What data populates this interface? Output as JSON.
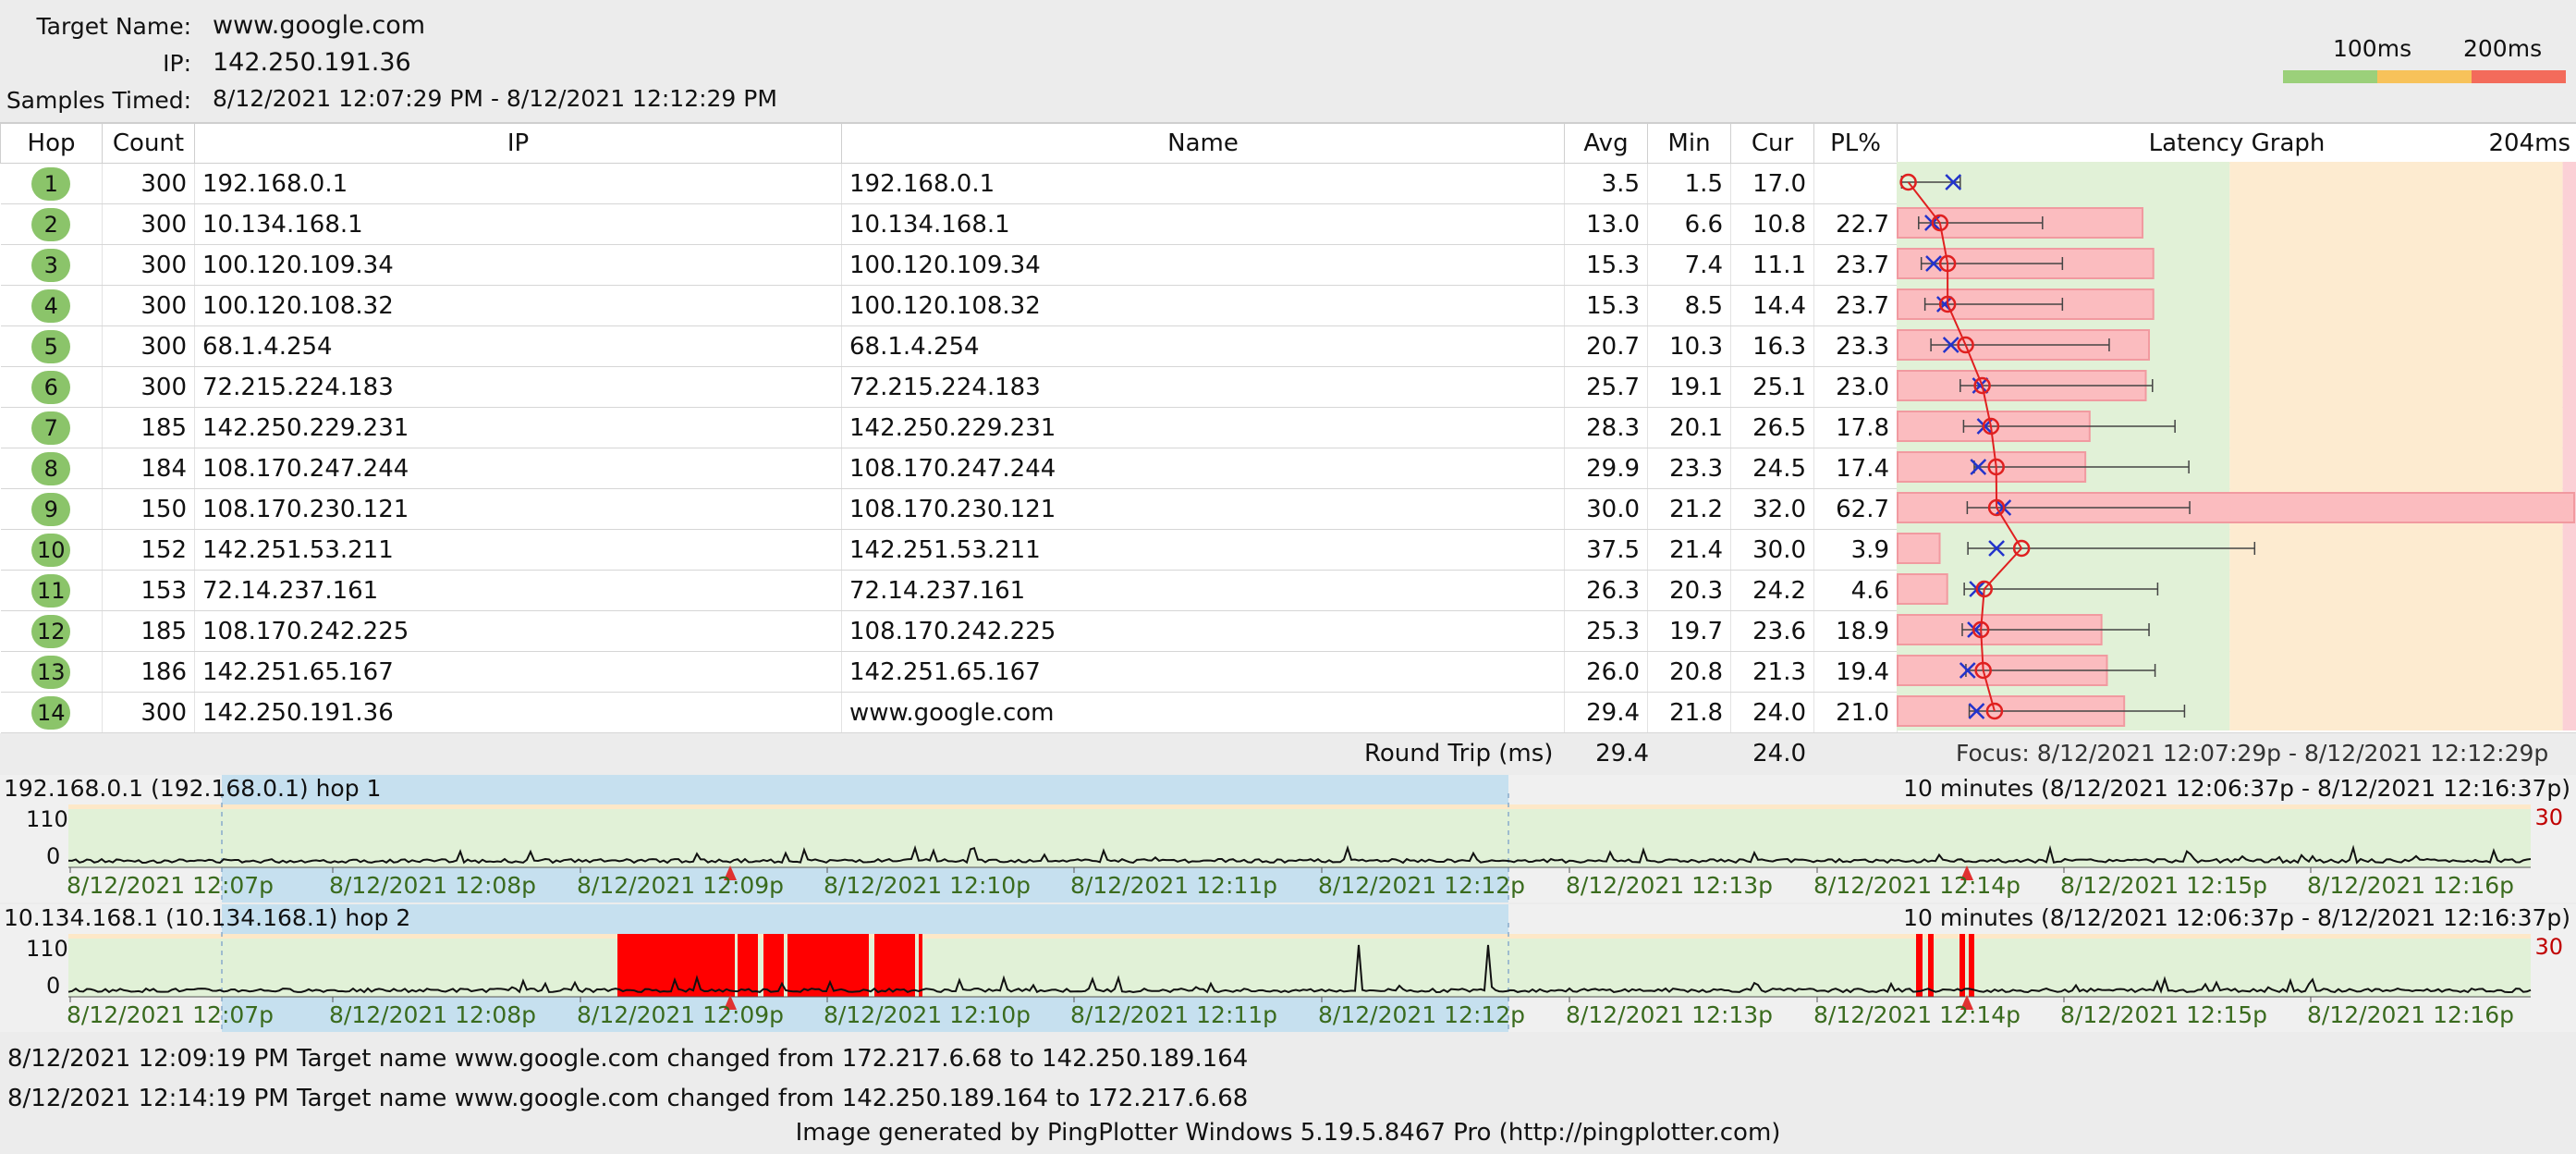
{
  "header": {
    "target_label": "Target Name:",
    "target_value": "www.google.com",
    "ip_label": "IP:",
    "ip_value": "142.250.191.36",
    "samples_label": "Samples Timed:",
    "samples_value": "8/12/2021 12:07:29 PM - 8/12/2021 12:12:29 PM",
    "scale_100": "100ms",
    "scale_200": "200ms",
    "scale_colors": [
      "#9bd07a",
      "#f7c25a",
      "#f36b5b"
    ]
  },
  "columns": {
    "hop": "Hop",
    "count": "Count",
    "ip": "IP",
    "name": "Name",
    "avg": "Avg",
    "min": "Min",
    "cur": "Cur",
    "pl": "PL%",
    "latency_graph": "Latency Graph",
    "max_ms": "204ms"
  },
  "rows": [
    {
      "hop": "1",
      "count": "300",
      "ip": "192.168.0.1",
      "name": "192.168.0.1",
      "avg": "3.5",
      "min": "1.5",
      "cur": "17.0",
      "pl": "",
      "plv": 0
    },
    {
      "hop": "2",
      "count": "300",
      "ip": "10.134.168.1",
      "name": "10.134.168.1",
      "avg": "13.0",
      "min": "6.6",
      "cur": "10.8",
      "pl": "22.7",
      "plv": 22.7
    },
    {
      "hop": "3",
      "count": "300",
      "ip": "100.120.109.34",
      "name": "100.120.109.34",
      "avg": "15.3",
      "min": "7.4",
      "cur": "11.1",
      "pl": "23.7",
      "plv": 23.7
    },
    {
      "hop": "4",
      "count": "300",
      "ip": "100.120.108.32",
      "name": "100.120.108.32",
      "avg": "15.3",
      "min": "8.5",
      "cur": "14.4",
      "pl": "23.7",
      "plv": 23.7
    },
    {
      "hop": "5",
      "count": "300",
      "ip": "68.1.4.254",
      "name": "68.1.4.254",
      "avg": "20.7",
      "min": "10.3",
      "cur": "16.3",
      "pl": "23.3",
      "plv": 23.3
    },
    {
      "hop": "6",
      "count": "300",
      "ip": "72.215.224.183",
      "name": "72.215.224.183",
      "avg": "25.7",
      "min": "19.1",
      "cur": "25.1",
      "pl": "23.0",
      "plv": 23.0
    },
    {
      "hop": "7",
      "count": "185",
      "ip": "142.250.229.231",
      "name": "142.250.229.231",
      "avg": "28.3",
      "min": "20.1",
      "cur": "26.5",
      "pl": "17.8",
      "plv": 17.8
    },
    {
      "hop": "8",
      "count": "184",
      "ip": "108.170.247.244",
      "name": "108.170.247.244",
      "avg": "29.9",
      "min": "23.3",
      "cur": "24.5",
      "pl": "17.4",
      "plv": 17.4
    },
    {
      "hop": "9",
      "count": "150",
      "ip": "108.170.230.121",
      "name": "108.170.230.121",
      "avg": "30.0",
      "min": "21.2",
      "cur": "32.0",
      "pl": "62.7",
      "plv": 62.7
    },
    {
      "hop": "10",
      "count": "152",
      "ip": "142.251.53.211",
      "name": "142.251.53.211",
      "avg": "37.5",
      "min": "21.4",
      "cur": "30.0",
      "pl": "3.9",
      "plv": 3.9
    },
    {
      "hop": "11",
      "count": "153",
      "ip": "72.14.237.161",
      "name": "72.14.237.161",
      "avg": "26.3",
      "min": "20.3",
      "cur": "24.2",
      "pl": "4.6",
      "plv": 4.6
    },
    {
      "hop": "12",
      "count": "185",
      "ip": "108.170.242.225",
      "name": "108.170.242.225",
      "avg": "25.3",
      "min": "19.7",
      "cur": "23.6",
      "pl": "18.9",
      "plv": 18.9
    },
    {
      "hop": "13",
      "count": "186",
      "ip": "142.251.65.167",
      "name": "142.251.65.167",
      "avg": "26.0",
      "min": "20.8",
      "cur": "21.3",
      "pl": "19.4",
      "plv": 19.4
    },
    {
      "hop": "14",
      "count": "300",
      "ip": "142.250.191.36",
      "name": "www.google.com",
      "avg": "29.4",
      "min": "21.8",
      "cur": "24.0",
      "pl": "21.0",
      "plv": 21.0
    }
  ],
  "round_trip": {
    "label": "Round Trip (ms)",
    "avg": "29.4",
    "cur": "24.0"
  },
  "focus": "Focus: 8/12/2021 12:07:29p - 8/12/2021 12:12:29p",
  "time_graphs": [
    {
      "title": "192.168.0.1 (192.168.0.1) hop 1",
      "range": "10 minutes (8/12/2021 12:06:37p - 8/12/2021 12:16:37p)",
      "y_max": "110",
      "y_min": "0",
      "pl_max": "30"
    },
    {
      "title": "10.134.168.1 (10.134.168.1) hop 2",
      "range": "10 minutes (8/12/2021 12:06:37p - 8/12/2021 12:16:37p)",
      "y_max": "110",
      "y_min": "0",
      "pl_max": "30"
    }
  ],
  "time_ticks": [
    "8/12/2021 12:07p",
    "8/12/2021 12:08p",
    "8/12/2021 12:09p",
    "8/12/2021 12:10p",
    "8/12/2021 12:11p",
    "8/12/2021 12:12p",
    "8/12/2021 12:13p",
    "8/12/2021 12:14p",
    "8/12/2021 12:15p",
    "8/12/2021 12:16p"
  ],
  "events": [
    "8/12/2021 12:09:19 PM Target name www.google.com changed from 172.217.6.68 to 142.250.189.164",
    "8/12/2021 12:14:19 PM Target name www.google.com changed from 142.250.189.164 to 172.217.6.68"
  ],
  "footer": "Image generated by PingPlotter Windows 5.19.5.8467 Pro (http://pingplotter.com)"
}
